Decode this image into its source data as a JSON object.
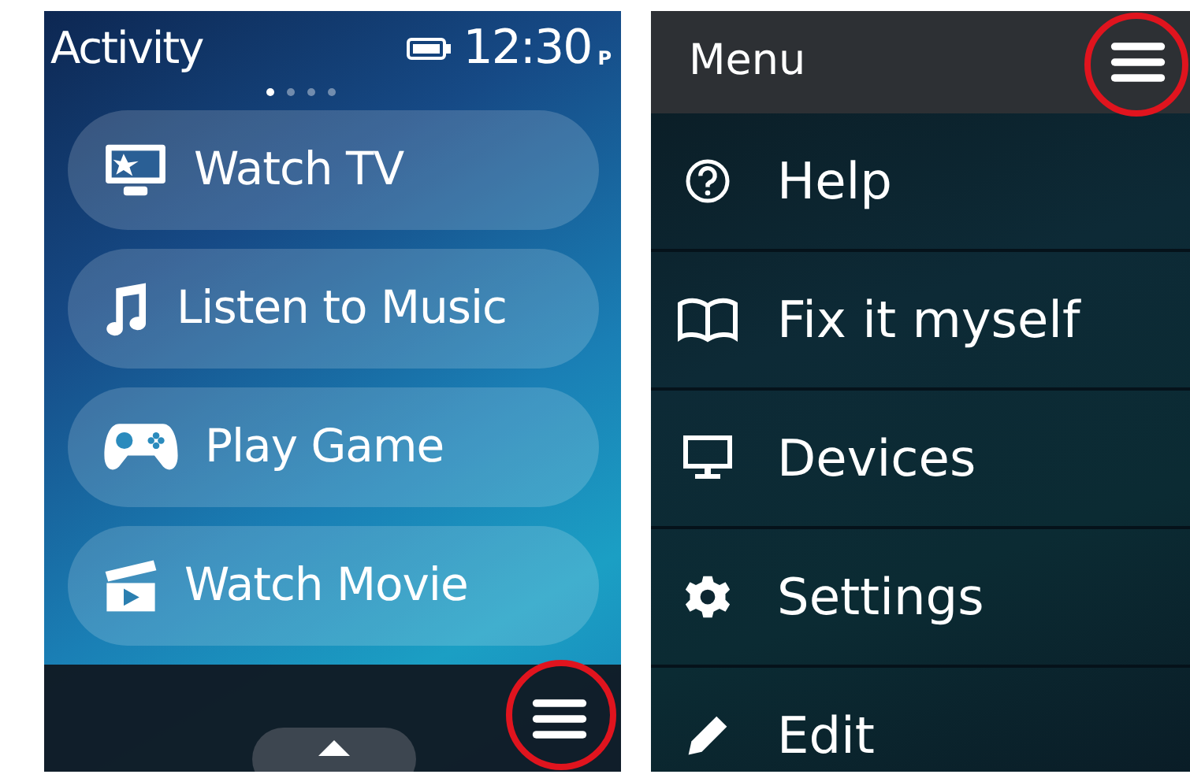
{
  "activity_screen": {
    "title": "Activity",
    "time": "12:30",
    "time_suffix": "P",
    "page_dots": [
      {
        "selected": true
      },
      {
        "selected": false
      },
      {
        "selected": false
      },
      {
        "selected": false
      }
    ],
    "activities": [
      {
        "label": "Watch TV",
        "kind": "tv"
      },
      {
        "label": "Listen to Music",
        "kind": "music"
      },
      {
        "label": "Play Game",
        "kind": "game"
      },
      {
        "label": "Watch Movie",
        "kind": "movie"
      }
    ],
    "menu_button_highlighted": true
  },
  "menu_screen": {
    "title": "Menu",
    "menu_button_highlighted": true,
    "items": [
      {
        "label": "Help",
        "kind": "help"
      },
      {
        "label": "Fix it myself",
        "kind": "book"
      },
      {
        "label": "Devices",
        "kind": "monitor"
      },
      {
        "label": "Settings",
        "kind": "gear"
      },
      {
        "label": "Edit",
        "kind": "pencil"
      }
    ]
  }
}
